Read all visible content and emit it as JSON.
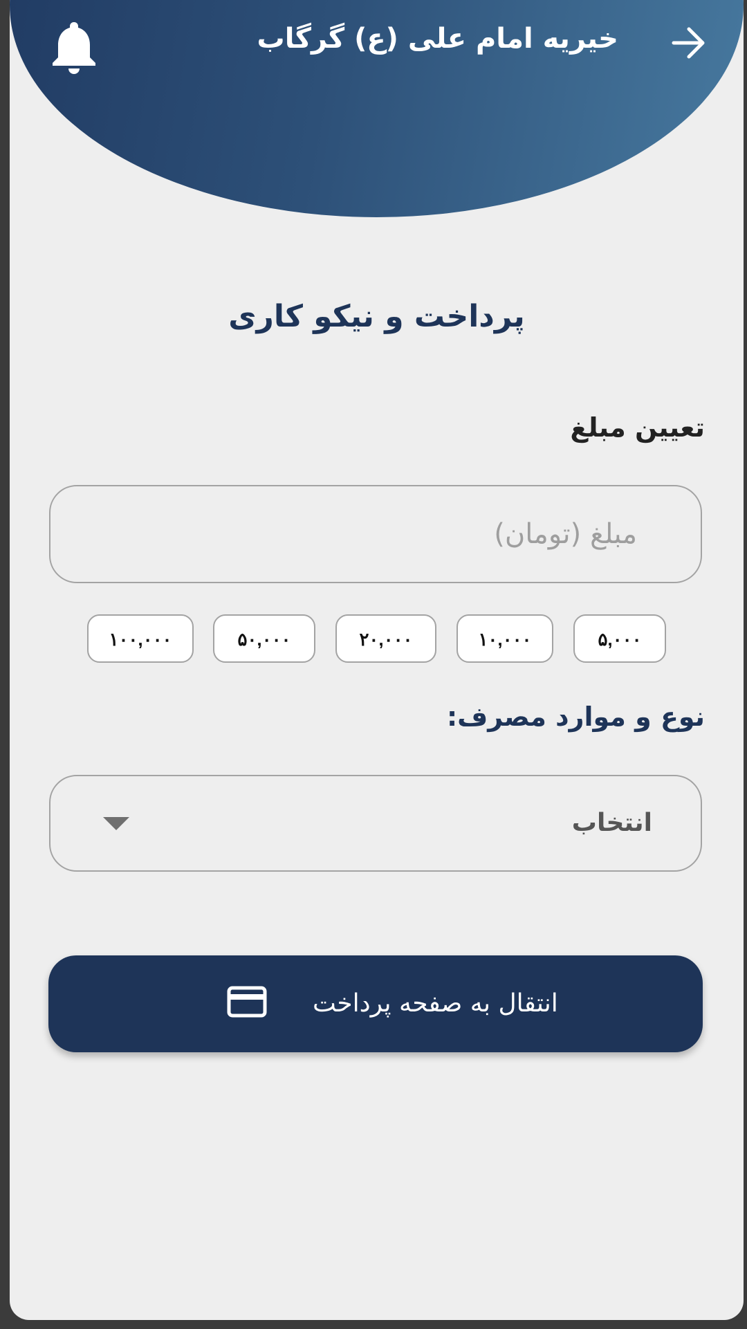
{
  "header": {
    "title": "خیریه امام علی (ع) گرگاب",
    "back_icon": "arrow-right-icon",
    "notification_icon": "bell-icon",
    "gradient": [
      "#203a62",
      "#47799f"
    ]
  },
  "page": {
    "title": "پرداخت و نیکو کاری"
  },
  "amount": {
    "label": "تعیین مبلغ",
    "placeholder": "مبلغ (تومان)",
    "value": "",
    "presets": [
      "۱۰۰,۰۰۰",
      "۵۰,۰۰۰",
      "۲۰,۰۰۰",
      "۱۰,۰۰۰",
      "۵,۰۰۰"
    ]
  },
  "usage": {
    "label": "نوع و موارد مصرف:",
    "selected": "انتخاب"
  },
  "pay_button": {
    "label": "انتقال به صفحه پرداخت",
    "icon": "credit-card-icon",
    "color": "#1e3458"
  }
}
